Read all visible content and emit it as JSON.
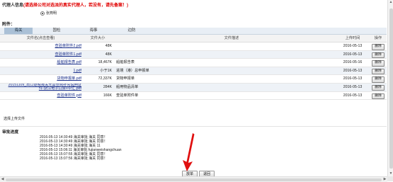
{
  "agent": {
    "title": "代理人信息",
    "warning": "(请选择公司对选派的真实代理人，若没有，请先备案！)",
    "radio_label": "张燕明"
  },
  "attachments": {
    "title": "附件：",
    "tabs": [
      "海关",
      "国检",
      "海事",
      "边防"
    ],
    "active_tab": 0,
    "columns": [
      "文件名(点击查看)",
      "文件大小",
      "文件描述",
      "上传时间",
      "操作"
    ],
    "rows": [
      {
        "name": "查验单附件2.pdf",
        "size": "48K",
        "desc": "",
        "date": "2016-05-13",
        "op": "删除"
      },
      {
        "name": "查验单附件1.pdf",
        "size": "48K",
        "desc": "",
        "date": "2016-05-13",
        "op": "删除"
      },
      {
        "name": "船舶报告表.pdf",
        "size": "18,467K",
        "desc": "船舶报告表",
        "date": "2016-05-16",
        "op": "删除"
      },
      {
        "name": "1.pdf",
        "size": "小于1K",
        "desc": "进境（港）总申报单",
        "date": "2016-05-13",
        "op": "删除"
      },
      {
        "name": "货物申报单.pdf",
        "size": "72,337K",
        "desc": "货物申报单",
        "date": "2016-05-13",
        "op": "删除"
      },
      {
        "name": "20151109_出口退税报关无需查阅补充说明证件-浙江电子口岸+中汇.pdf",
        "name_line1": "20151109_出口退税报关无需查阅补充说明证",
        "name_line2": "件-浙江电子口岸+中汇.pdf",
        "size": "284K",
        "desc": "船用物品清单",
        "date": "2016-05-13",
        "op": "删除"
      },
      {
        "name": "查验单附件.pdf",
        "size": "166K",
        "desc": "查验单附件单",
        "date": "2016-05-13",
        "op": "删除"
      }
    ],
    "upload_label": "选择上传文件"
  },
  "progress": {
    "title": "审批进度",
    "entries": [
      "2016-05-13 14:30:49 海关审批 海关 同意！",
      "2016-05-13 14:30:49 海关审批 海关 同意！",
      "2016-05-13 14:30:49 海关审批 海关 11",
      "2016-05-13 15:06:11 海关审批 fujianweishangchuan",
      "2016-05-13 15:07:55 海关审批 海关 同意！",
      "2016-05-13 15:07:56 海关审批 海关 同意！"
    ]
  },
  "buttons": {
    "approve": "放单",
    "reject": "退回"
  },
  "colors": {
    "warning": "#e00000",
    "tab_active": "#aac0d6",
    "arrow": "#e01010"
  },
  "icons": {
    "pointer": "red-arrow-icon"
  }
}
